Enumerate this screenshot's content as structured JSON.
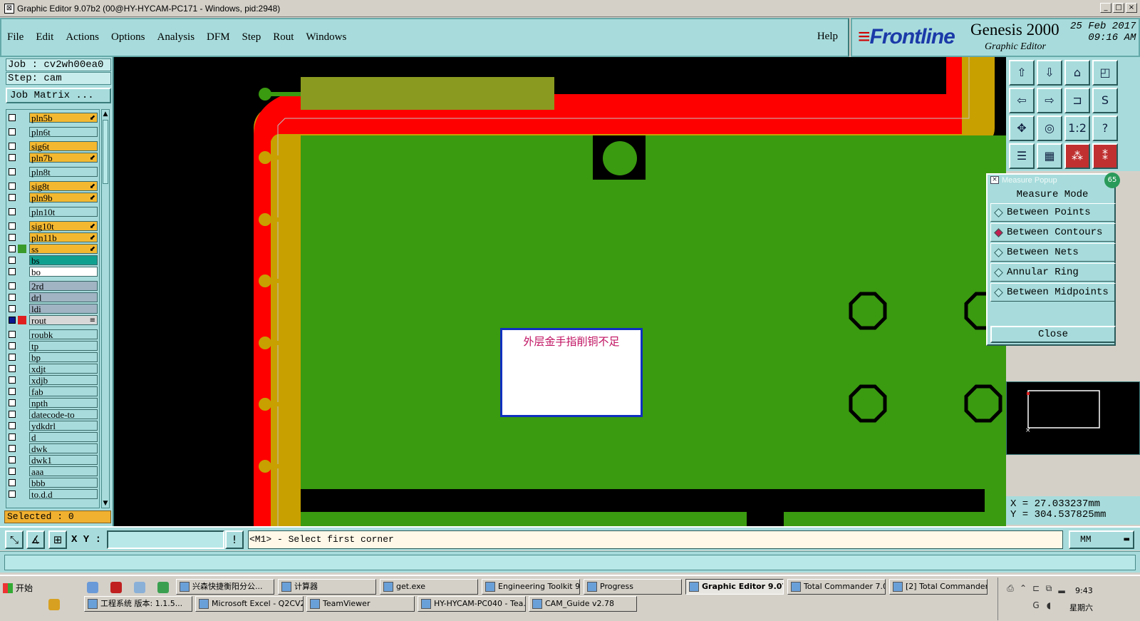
{
  "window": {
    "title": "Graphic Editor 9.07b2 (00@HY-HYCAM-PC171 - Windows, pid:2948)",
    "controls": [
      "_",
      "□",
      "×"
    ]
  },
  "menu": {
    "items": [
      "File",
      "Edit",
      "Actions",
      "Options",
      "Analysis",
      "DFM",
      "Step",
      "Rout",
      "Windows"
    ],
    "help": "Help"
  },
  "brand": {
    "logo": "Frontline",
    "product": "Genesis 2000",
    "subtitle": "Graphic Editor",
    "date": "25 Feb 2017",
    "time": "09:16 AM"
  },
  "job": {
    "job_label": "Job : cv2wh00ea0",
    "step_label": "Step: cam",
    "matrix_button": "Job Matrix ...",
    "selected": "Selected : 0"
  },
  "layers": [
    {
      "name": "pln5b",
      "bg": "#f4b830",
      "mark": "⬋",
      "color": ""
    },
    {
      "name": "pln6t",
      "bg": "#a8dcdc",
      "mark": "",
      "color": ""
    },
    {
      "name": "sig6t",
      "bg": "#f4b830",
      "mark": "",
      "color": ""
    },
    {
      "name": "pln7b",
      "bg": "#f4b830",
      "mark": "⬋",
      "color": ""
    },
    {
      "name": "pln8t",
      "bg": "#a8dcdc",
      "mark": "",
      "color": ""
    },
    {
      "name": "sig8t",
      "bg": "#f4b830",
      "mark": "⬋",
      "color": ""
    },
    {
      "name": "pln9b",
      "bg": "#f4b830",
      "mark": "⬋",
      "color": ""
    },
    {
      "name": "pln10t",
      "bg": "#a8dcdc",
      "mark": "",
      "color": ""
    },
    {
      "name": "sig10t",
      "bg": "#f4b830",
      "mark": "⬋",
      "color": ""
    },
    {
      "name": "pln11b",
      "bg": "#f4b830",
      "mark": "⬋",
      "color": ""
    },
    {
      "name": "ss",
      "bg": "#f4b830",
      "mark": "⬋",
      "color": "#3a9a2a"
    },
    {
      "name": "bs",
      "bg": "#10a090",
      "mark": "",
      "color": ""
    },
    {
      "name": "bo",
      "bg": "#ffffff",
      "mark": "",
      "color": ""
    },
    {
      "name": "2rd",
      "bg": "#a0b4c4",
      "mark": "",
      "color": ""
    },
    {
      "name": "drl",
      "bg": "#a0b4c4",
      "mark": "",
      "color": ""
    },
    {
      "name": "ldi",
      "bg": "#a0b4c4",
      "mark": "",
      "color": ""
    },
    {
      "name": "rout",
      "bg": "#d8d8d8",
      "mark": "≡",
      "color": "#e02020",
      "checked": true
    },
    {
      "name": "roubk",
      "bg": "#a8dcdc",
      "mark": "",
      "color": ""
    },
    {
      "name": "tp",
      "bg": "#a8dcdc",
      "mark": "",
      "color": ""
    },
    {
      "name": "bp",
      "bg": "#a8dcdc",
      "mark": "",
      "color": ""
    },
    {
      "name": "xdjt",
      "bg": "#a8dcdc",
      "mark": "",
      "color": ""
    },
    {
      "name": "xdjb",
      "bg": "#a8dcdc",
      "mark": "",
      "color": ""
    },
    {
      "name": "fab",
      "bg": "#a8dcdc",
      "mark": "",
      "color": ""
    },
    {
      "name": "npth",
      "bg": "#a8dcdc",
      "mark": "",
      "color": ""
    },
    {
      "name": "datecode-to",
      "bg": "#a8dcdc",
      "mark": "",
      "color": ""
    },
    {
      "name": "ydkdrl",
      "bg": "#a8dcdc",
      "mark": "",
      "color": ""
    },
    {
      "name": "d",
      "bg": "#a8dcdc",
      "mark": "",
      "color": ""
    },
    {
      "name": "dwk",
      "bg": "#a8dcdc",
      "mark": "",
      "color": ""
    },
    {
      "name": "dwk1",
      "bg": "#a8dcdc",
      "mark": "",
      "color": ""
    },
    {
      "name": "aaa",
      "bg": "#a8dcdc",
      "mark": "",
      "color": ""
    },
    {
      "name": "bbb",
      "bg": "#a8dcdc",
      "mark": "",
      "color": ""
    },
    {
      "name": "to.d.d",
      "bg": "#a8dcdc",
      "mark": "",
      "color": ""
    }
  ],
  "canvas": {
    "callout_text": "外层金手指削铜不足",
    "colors": {
      "copper": "#3a9a10",
      "rout": "#ff0000",
      "gold": "#c8a000",
      "background": "#000000"
    }
  },
  "measure": {
    "title": "Measure Popup",
    "badge": "65",
    "mode_label": "Measure Mode",
    "options": [
      {
        "label": "Between Points",
        "selected": false
      },
      {
        "label": "Between Contours",
        "selected": true
      },
      {
        "label": "Between Nets",
        "selected": false
      },
      {
        "label": "Annular Ring",
        "selected": false
      },
      {
        "label": "Between Midpoints",
        "selected": false
      }
    ],
    "close": "Close"
  },
  "coords": {
    "x": "X = 27.033237mm",
    "y": "Y = 304.537825mm"
  },
  "command": {
    "xy_label": "X Y :",
    "xy_value": "",
    "prompt": "<M1> - Select first corner",
    "units": "MM"
  },
  "taskbar": {
    "start": "开始",
    "row1": [
      "兴森快捷衡阳分公...",
      "计算器",
      "get.exe",
      "Engineering Toolkit 9....",
      "Progress",
      "Graphic Editor 9.07...",
      "Total Commander 7.0...",
      "[2] Total Commander..."
    ],
    "row2": [
      "工程系统  版本: 1.1.5...",
      "Microsoft Excel - Q2CV2...",
      "TeamViewer",
      "HY-HYCAM-PC040 - Tea...",
      "CAM_Guide v2.78"
    ],
    "time": "9:43",
    "day": "星期六"
  }
}
